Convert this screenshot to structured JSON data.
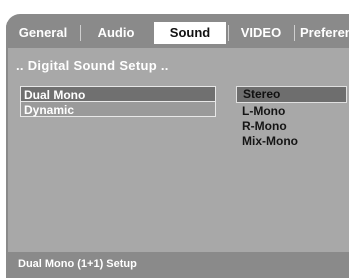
{
  "tabs": [
    {
      "label": "General"
    },
    {
      "label": "Audio"
    },
    {
      "label": "Sound",
      "active": true
    },
    {
      "label": "VIDEO"
    },
    {
      "label": "Preferen"
    }
  ],
  "panel": {
    "title": ".. Digital Sound Setup .."
  },
  "options": [
    {
      "label": "Dual Mono",
      "selected": true
    },
    {
      "label": "Dynamic"
    }
  ],
  "values": [
    {
      "label": "Stereo",
      "selected": true
    },
    {
      "label": "L-Mono"
    },
    {
      "label": "R-Mono"
    },
    {
      "label": "Mix-Mono"
    }
  ],
  "status": {
    "text": "Dual Mono (1+1) Setup"
  }
}
